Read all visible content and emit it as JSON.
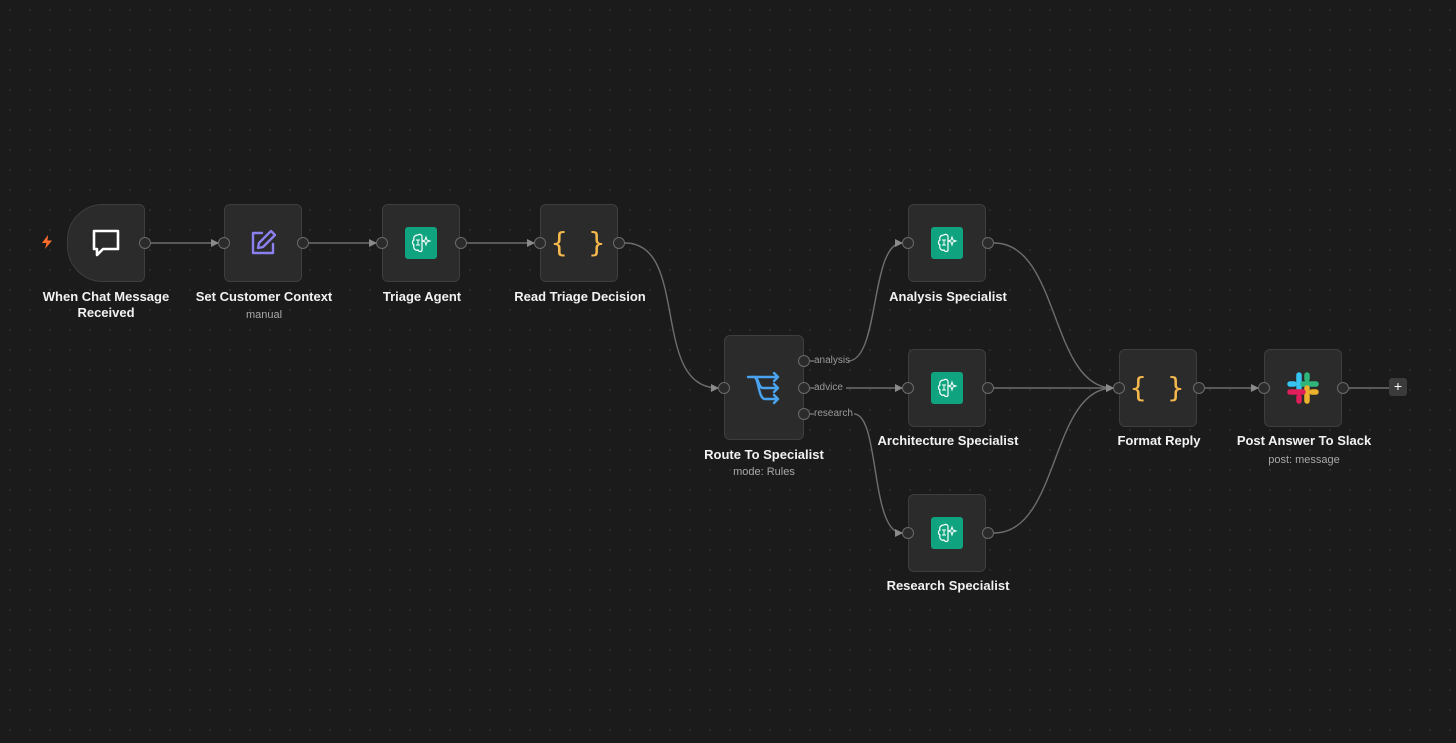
{
  "workflow": {
    "nodes": {
      "chat_trigger": {
        "title": "When Chat Message Received",
        "icon": "chat-bubble-icon"
      },
      "set_context": {
        "title": "Set Customer Context",
        "subtitle": "manual",
        "icon": "edit-pencil-icon"
      },
      "triage_agent": {
        "title": "Triage Agent",
        "icon": "ai-brain-icon"
      },
      "read_triage": {
        "title": "Read Triage Decision",
        "icon": "code-braces-icon"
      },
      "route": {
        "title": "Route To Specialist",
        "subtitle": "mode: Rules",
        "icon": "router-arrows-icon",
        "outputs": [
          "analysis",
          "advice",
          "research"
        ]
      },
      "analysis": {
        "title": "Analysis Specialist",
        "icon": "ai-brain-icon"
      },
      "architecture": {
        "title": "Architecture Specialist",
        "icon": "ai-brain-icon"
      },
      "research": {
        "title": "Research Specialist",
        "icon": "ai-brain-icon"
      },
      "format_reply": {
        "title": "Format Reply",
        "icon": "code-braces-icon"
      },
      "slack": {
        "title": "Post Answer To Slack",
        "subtitle": "post: message",
        "icon": "slack-logo-icon"
      }
    },
    "add_button": "+",
    "braces_glyph": "{ }"
  },
  "colors": {
    "canvas": "#1b1b1b",
    "node": "#2b2b2b",
    "ai_green": "#10a37f",
    "code_yellow": "#f5b84c",
    "router_blue": "#4aa3f0",
    "edit_purple": "#8b80f0",
    "trigger_orange": "#ff6d2d"
  }
}
